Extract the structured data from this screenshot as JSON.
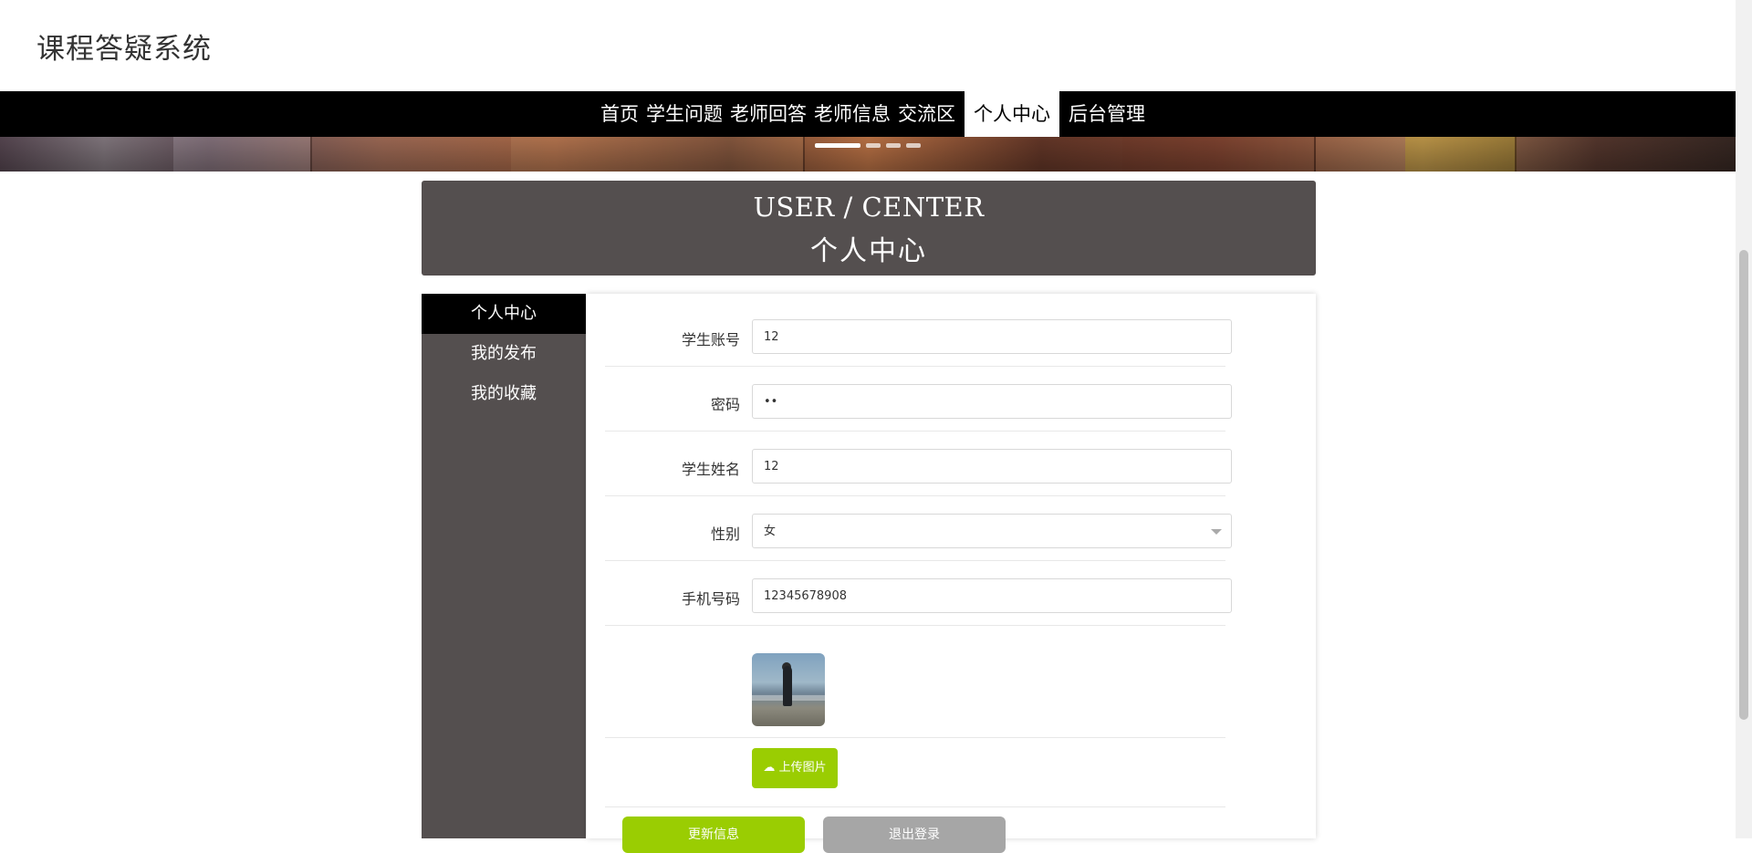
{
  "site": {
    "title": "课程答疑系统"
  },
  "nav": {
    "items": [
      {
        "label": "首页"
      },
      {
        "label": "学生问题"
      },
      {
        "label": "老师回答"
      },
      {
        "label": "老师信息"
      },
      {
        "label": "交流区"
      },
      {
        "label": "个人中心",
        "active": true
      },
      {
        "label": "后台管理"
      }
    ]
  },
  "carousel": {
    "slide_count": 4,
    "active_index": 0
  },
  "header": {
    "en": "USER / CENTER",
    "zh": "个人中心"
  },
  "sidebar": {
    "items": [
      {
        "label": "个人中心",
        "active": true
      },
      {
        "label": "我的发布"
      },
      {
        "label": "我的收藏"
      }
    ]
  },
  "form": {
    "account": {
      "label": "学生账号",
      "value": "12"
    },
    "password": {
      "label": "密码",
      "value": "••"
    },
    "name": {
      "label": "学生姓名",
      "value": "12"
    },
    "gender": {
      "label": "性别",
      "value": "女"
    },
    "phone": {
      "label": "手机号码",
      "value": "12345678908"
    },
    "upload_label": "上传图片",
    "update_label": "更新信息",
    "logout_label": "退出登录"
  },
  "colors": {
    "nav_bg": "#000000",
    "panel_dark": "#544f4f",
    "upload_green": "#9acd02",
    "logout_gray": "#a6a6a6"
  }
}
